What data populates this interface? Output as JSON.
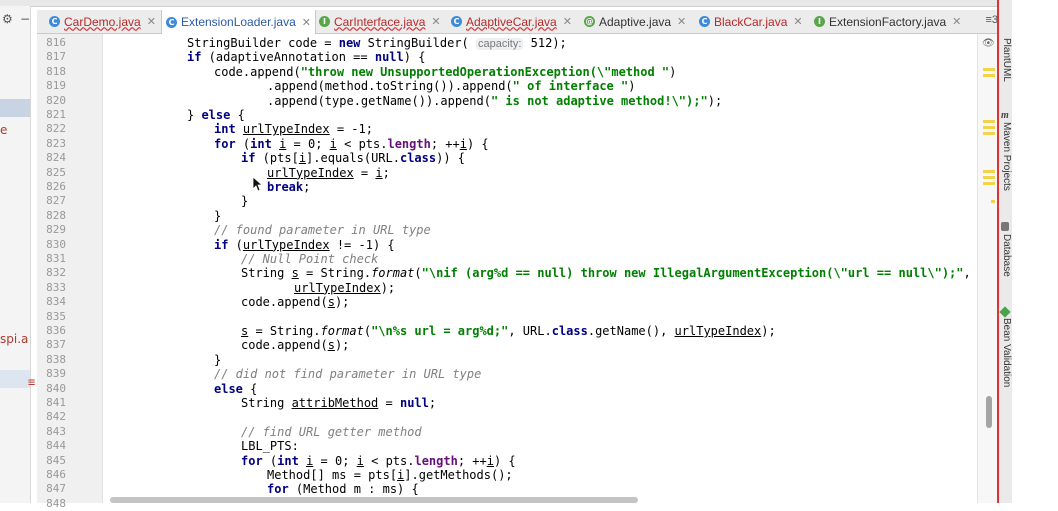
{
  "tabs": [
    {
      "label": "CarDemo.java",
      "icon": "class-icon",
      "state": "error"
    },
    {
      "label": "ExtensionLoader.java",
      "icon": "class-icon",
      "state": "active"
    },
    {
      "label": "CarInterface.java",
      "icon": "interface-icon",
      "state": "error"
    },
    {
      "label": "AdaptiveCar.java",
      "icon": "class-icon",
      "state": "error"
    },
    {
      "label": "Adaptive.java",
      "icon": "annotation-icon",
      "state": "normal"
    },
    {
      "label": "BlackCar.java",
      "icon": "class-icon",
      "state": "plain-error"
    },
    {
      "label": "ExtensionFactory.java",
      "icon": "interface-icon",
      "state": "normal"
    }
  ],
  "tabs_overflow": "≡3",
  "left_panel": {
    "fragment_1": "e",
    "fragment_2": "spi.a"
  },
  "editor": {
    "first_line": 816,
    "current_line": 822,
    "lines": [
      {
        "n": "816",
        "text": "StringBuilder code = new StringBuilder( capacity: 512);"
      },
      {
        "n": "817",
        "text": "if (adaptiveAnnotation == null) {"
      },
      {
        "n": "818",
        "text": "code.append(\"throw new UnsupportedOperationException(\\\"method \")"
      },
      {
        "n": "819",
        "text": ".append(method.toString()).append(\" of interface \")"
      },
      {
        "n": "820",
        "text": ".append(type.getName()).append(\" is not adaptive method!\\\");\");"
      },
      {
        "n": "821",
        "text": "} else {"
      },
      {
        "n": "822",
        "text": "int urlTypeIndex = -1;"
      },
      {
        "n": "823",
        "text": "for (int i = 0; i < pts.length; ++i) {"
      },
      {
        "n": "824",
        "text": "if (pts[i].equals(URL.class)) {"
      },
      {
        "n": "825",
        "text": "urlTypeIndex = i;"
      },
      {
        "n": "826",
        "text": "break;"
      },
      {
        "n": "827",
        "text": "}"
      },
      {
        "n": "828",
        "text": "}"
      },
      {
        "n": "829",
        "text": "// found parameter in URL type"
      },
      {
        "n": "830",
        "text": "if (urlTypeIndex != -1) {"
      },
      {
        "n": "831",
        "text": "// Null Point check"
      },
      {
        "n": "832",
        "text": "String s = String.format(\"\\nif (arg%d == null) throw new IllegalArgumentException(\\\"url == null\\\");\","
      },
      {
        "n": "833",
        "text": "urlTypeIndex);"
      },
      {
        "n": "834",
        "text": "code.append(s);"
      },
      {
        "n": "835",
        "text": ""
      },
      {
        "n": "836",
        "text": "s = String.format(\"\\n%s url = arg%d;\", URL.class.getName(), urlTypeIndex);"
      },
      {
        "n": "837",
        "text": "code.append(s);"
      },
      {
        "n": "838",
        "text": "}"
      },
      {
        "n": "839",
        "text": "// did not find parameter in URL type"
      },
      {
        "n": "840",
        "text": "else {"
      },
      {
        "n": "841",
        "text": "String attribMethod = null;"
      },
      {
        "n": "842",
        "text": ""
      },
      {
        "n": "843",
        "text": "// find URL getter method"
      },
      {
        "n": "844",
        "text": "LBL_PTS:"
      },
      {
        "n": "845",
        "text": "for (int i = 0; i < pts.length; ++i) {"
      },
      {
        "n": "846",
        "text": "Method[] ms = pts[i].getMethods();"
      },
      {
        "n": "847",
        "text": "for (Method m : ms) {"
      },
      {
        "n": "848",
        "text": ""
      }
    ]
  },
  "tool_windows": [
    {
      "label": "PlantUML",
      "icon": "plantuml-icon"
    },
    {
      "label": "Maven Projects",
      "icon": "maven-icon"
    },
    {
      "label": "Database",
      "icon": "database-icon"
    },
    {
      "label": "Bean Validation",
      "icon": "bean-validation-icon"
    }
  ],
  "colors": {
    "keyword": "#000080",
    "string": "#008000",
    "comment": "#808080",
    "current_line": "#fffbdc",
    "error_border": "#e03232"
  }
}
